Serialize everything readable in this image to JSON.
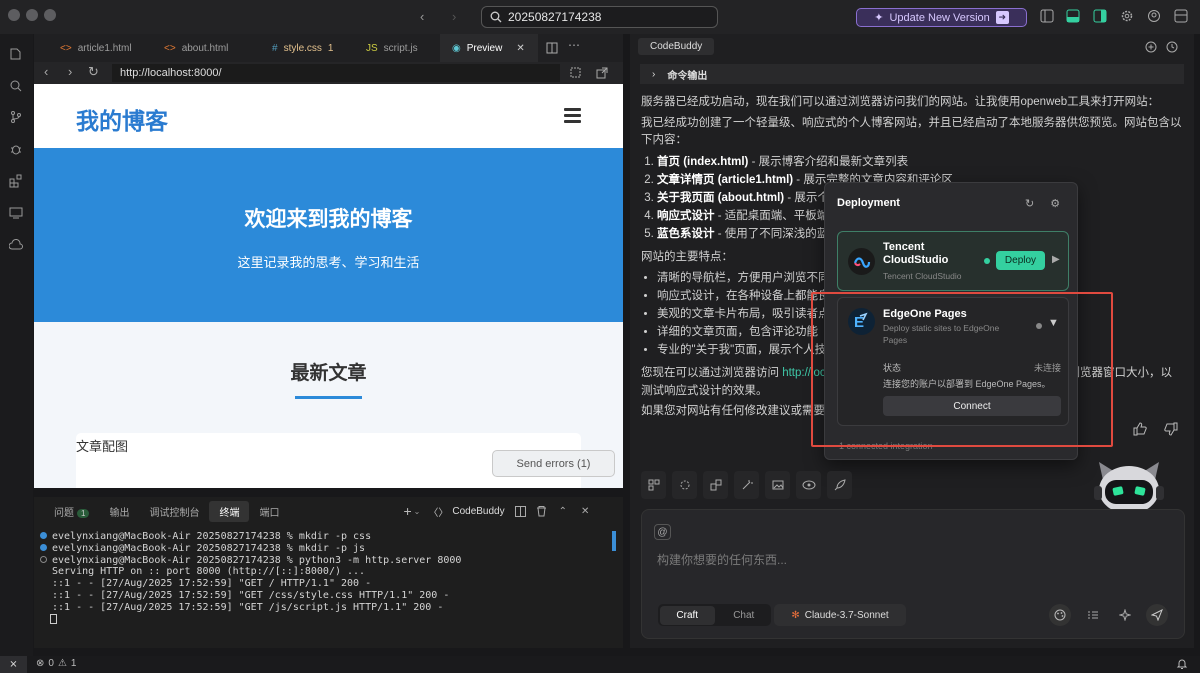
{
  "titlebar": {
    "search_text": "20250827174238",
    "update_label": "Update New Version"
  },
  "editor": {
    "tabs": [
      {
        "label": "article1.html",
        "icon": "html-icon"
      },
      {
        "label": "about.html",
        "icon": "html-icon"
      },
      {
        "label": "style.css",
        "icon": "css-icon",
        "badge": "1"
      },
      {
        "label": "script.js",
        "icon": "js-icon"
      },
      {
        "label": "Preview",
        "icon": "eye-icon"
      }
    ],
    "url": "http://localhost:8000/"
  },
  "preview": {
    "logo": "我的博客",
    "hero_title": "欢迎来到我的博客",
    "hero_subtitle": "这里记录我的思考、学习和生活",
    "section_title": "最新文章",
    "card_alt": "文章配图",
    "send_errors": "Send errors (1)"
  },
  "terminal": {
    "tabs": [
      {
        "label": "问题",
        "badge": "1"
      },
      {
        "label": "输出"
      },
      {
        "label": "调试控制台"
      },
      {
        "label": "终端"
      },
      {
        "label": "端口"
      }
    ],
    "active_tab": "终端",
    "shell_label": "CodeBuddy",
    "lines": [
      "evelynxiang@MacBook-Air 20250827174238 % mkdir -p css",
      "evelynxiang@MacBook-Air 20250827174238 % mkdir -p js",
      "evelynxiang@MacBook-Air 20250827174238 % python3 -m http.server 8000",
      "Serving HTTP on :: port 8000 (http://[::]:8000/) ...",
      "::1 - - [27/Aug/2025 17:52:59] \"GET / HTTP/1.1\" 200 -",
      "::1 - - [27/Aug/2025 17:52:59] \"GET /css/style.css HTTP/1.1\" 200 -",
      "::1 - - [27/Aug/2025 17:52:59] \"GET /js/script.js HTTP/1.1\" 200 -"
    ]
  },
  "assistant": {
    "title": "CodeBuddy",
    "command_output": "命令输出",
    "para1": "服务器已经成功启动，现在我们可以通过浏览器访问我们的网站。让我使用openweb工具来打开网站：",
    "para2": "我已经成功创建了一个轻量级、响应式的个人博客网站，并且已经启动了本地服务器供您预览。网站包含以下内容：",
    "list1": [
      {
        "bold": "首页 (index.html)",
        "rest": " - 展示博客介绍和最新文章列表"
      },
      {
        "bold": "文章详情页 (article1.html)",
        "rest": " - 展示完整的文章内容和评论区"
      },
      {
        "bold": "关于我页面 (about.html)",
        "rest": " - 展示个"
      },
      {
        "bold": "响应式设计",
        "rest": " - 适配桌面端、平板端和"
      },
      {
        "bold": "蓝色系设计",
        "rest": " - 使用了不同深浅的蓝色"
      }
    ],
    "features_title": "网站的主要特点：",
    "list2": [
      "清晰的导航栏，方便用户浏览不同页",
      "响应式设计，在各种设备上都能良好",
      "美观的文章卡片布局，吸引读者点击",
      "详细的文章页面，包含评论功能",
      "专业的\"关于我\"页面，展示个人技能"
    ],
    "para3_a": "您现在可以通过浏览器访问 ",
    "para3_link": "http://loca",
    "para3_b": "整浏览器窗口大小，以",
    "para3_c": "测试响应式设计的效果。",
    "para4": "如果您对网站有任何修改建议或需要添",
    "input_placeholder": "构建你想要的任何东西...",
    "modes": [
      "Craft",
      "Chat"
    ],
    "active_mode": "Craft",
    "model": "Claude-3.7-Sonnet"
  },
  "deployment": {
    "title": "Deployment",
    "providers": [
      {
        "name": "Tencent CloudStudio",
        "subtitle": "Tencent CloudStudio",
        "action": "Deploy"
      },
      {
        "name": "EdgeOne Pages",
        "subtitle": "Deploy static sites to EdgeOne Pages",
        "status_label": "状态",
        "status_value": "未连接",
        "status_desc": "连接您的账户以部署到 EdgeOne Pages。",
        "action": "Connect"
      }
    ],
    "footer": "1 connected integration"
  },
  "statusbar": {
    "errors": "0",
    "warnings": "1"
  }
}
